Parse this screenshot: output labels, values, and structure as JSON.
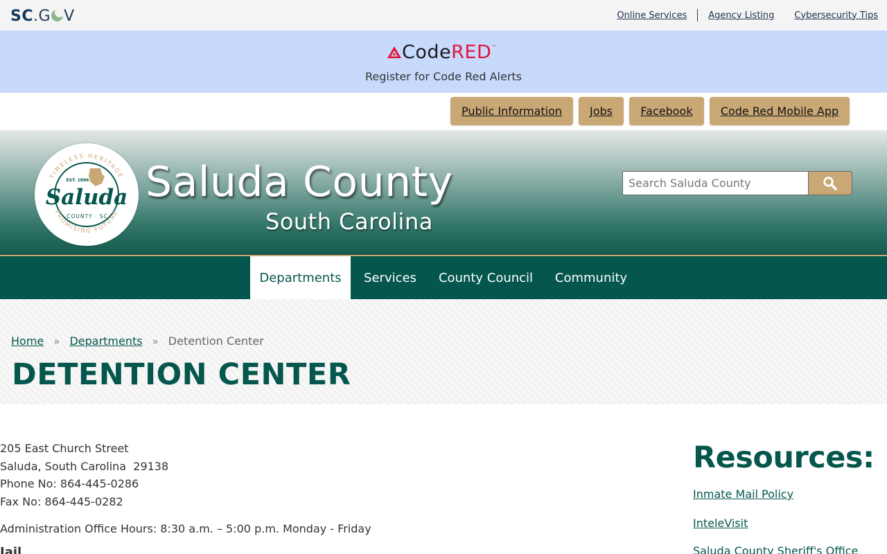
{
  "topbar": {
    "logo_bold": "SC",
    "logo_dot": ".",
    "logo_g": "G",
    "logo_v": "V",
    "links": [
      "Online Services",
      "Agency Listing",
      "Cybersecurity Tips"
    ]
  },
  "codered": {
    "brand_code": "Code",
    "brand_red": "RED",
    "brand_tm": "™",
    "subtitle": "Register for Code Red Alerts"
  },
  "quick_links": [
    "Public Information",
    "Jobs",
    "Facebook",
    "Code Red Mobile App"
  ],
  "header": {
    "seal_top_text": "TIMELESS HERITAGE",
    "seal_est": "EST. 1896",
    "seal_name": "Saluda",
    "seal_county": "COUNTY · SC",
    "seal_bottom_text": "PROMISING FUTURE",
    "title": "Saluda County",
    "subtitle": "South Carolina",
    "search_placeholder": "Search Saluda County"
  },
  "nav": {
    "items": [
      "Departments",
      "Services",
      "County Council",
      "Community"
    ],
    "active": "Departments"
  },
  "breadcrumb": {
    "home": "Home",
    "departments": "Departments",
    "current": "Detention Center",
    "separator": "»"
  },
  "page_title": "DETENTION CENTER",
  "contact": {
    "address_line1": "205 East Church Street",
    "address_line2": "Saluda, South Carolina  29138",
    "phone": "Phone No: 864-445-0286",
    "fax": "Fax No: 864-445-0282",
    "hours": "Administration Office Hours: 8:30 a.m. – 5:00 p.m. Monday - Friday",
    "next_heading": "Jail Administrator"
  },
  "resources": {
    "heading": "Resources:",
    "links": [
      "Inmate Mail Policy",
      "InteleVisit",
      "Saluda County Sheriff's Office"
    ]
  },
  "colors": {
    "brand_green": "#05574d",
    "tan": "#c9a876",
    "codered_bg": "#c7dafc",
    "codered_red": "#e3143b"
  }
}
